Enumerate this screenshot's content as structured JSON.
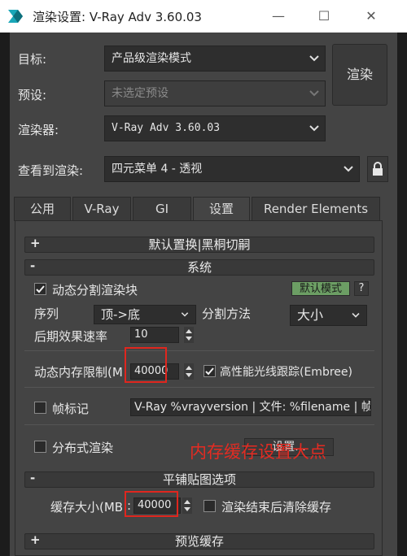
{
  "window": {
    "title": "渲染设置: V-Ray Adv 3.60.03",
    "app_icon": "3dsmax-logo-icon",
    "controls": {
      "minimize": "—",
      "maximize": "☐",
      "close": "✕"
    }
  },
  "form": {
    "target_label": "目标:",
    "target_value": "产品级渲染模式",
    "preset_label": "预设:",
    "preset_value": "未选定预设",
    "renderer_label": "渲染器:",
    "renderer_value": "V-Ray Adv 3.60.03",
    "view_label": "查看到渲染:",
    "view_value": "四元菜单 4 - 透视",
    "render_button": "渲染",
    "lock_icon": "lock-icon"
  },
  "tabs": [
    {
      "label": "公用",
      "active": false
    },
    {
      "label": "V-Ray",
      "active": false
    },
    {
      "label": "GI",
      "active": false
    },
    {
      "label": "设置",
      "active": true
    },
    {
      "label": "Render Elements",
      "active": false
    }
  ],
  "rollouts": {
    "r1": {
      "sign": "+",
      "title": "默认置换|黑桐切嗣"
    },
    "r2": {
      "sign": "-",
      "title": "系统"
    },
    "r3": {
      "sign": "-",
      "title": "平铺贴图选项"
    },
    "r4": {
      "sign": "+",
      "title": "预览缓存"
    }
  },
  "system": {
    "dynamic_split_label": "动态分割渲染块",
    "dynamic_split_checked": true,
    "default_mode_button": "默认模式",
    "help_button": "?",
    "sequence_label": "序列",
    "sequence_value": "顶->底",
    "split_method_label": "分割方法",
    "split_method_value": "大小",
    "post_effects_label": "后期效果速率",
    "post_effects_value": "10",
    "dynamic_memory_label": "动态内存限制(M",
    "dynamic_memory_value": "40000",
    "embree_label": "高性能光线跟踪(Embree)",
    "embree_checked": true,
    "frame_stamp_label": "帧标记",
    "frame_stamp_checked": false,
    "frame_stamp_template": "V-Ray %vrayversion | 文件: %filename | 帧",
    "distributed_label": "分布式渲染",
    "distributed_checked": false,
    "settings_button": "设置..."
  },
  "tiled": {
    "cache_size_label": "缓存大小(MB",
    "cache_size_value": "40000",
    "clear_cache_label": "渲染结束后清除缓存",
    "clear_cache_checked": false
  },
  "annotation": "内存缓存设置大点",
  "colors": {
    "annotation_red": "#e0261e",
    "default_mode_green": "#6c9e64",
    "panel_bg": "#444444",
    "window_bg": "#1c1c1c"
  }
}
